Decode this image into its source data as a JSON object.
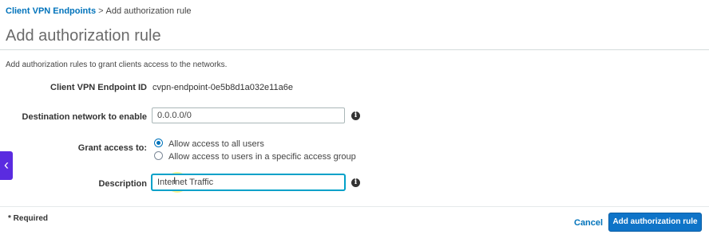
{
  "breadcrumb": {
    "link": "Client VPN Endpoints",
    "separator": ">",
    "current": "Add authorization rule"
  },
  "page": {
    "title": "Add authorization rule",
    "intro": "Add authorization rules to grant clients access to the networks."
  },
  "form": {
    "endpoint_id": {
      "label": "Client VPN Endpoint ID",
      "value": "cvpn-endpoint-0e5b8d1a032e11a6e"
    },
    "destination": {
      "label": "Destination network to enable",
      "value": "0.0.0.0/0"
    },
    "grant_access": {
      "label": "Grant access to:",
      "options": [
        {
          "label": "Allow access to all users",
          "checked": true
        },
        {
          "label": "Allow access to users in a specific access group",
          "checked": false
        }
      ]
    },
    "description": {
      "label": "Description",
      "value": "Internet Traffic"
    }
  },
  "footer": {
    "required_note": "* Required",
    "cancel_label": "Cancel",
    "submit_label": "Add authorization rule"
  },
  "icons": {
    "info": "info-icon",
    "back": "chevron-left-icon"
  },
  "colors": {
    "link": "#0073bb",
    "primary_button": "#0f74c8",
    "side_tab": "#5a2be0",
    "focus": "#00a1c9"
  }
}
